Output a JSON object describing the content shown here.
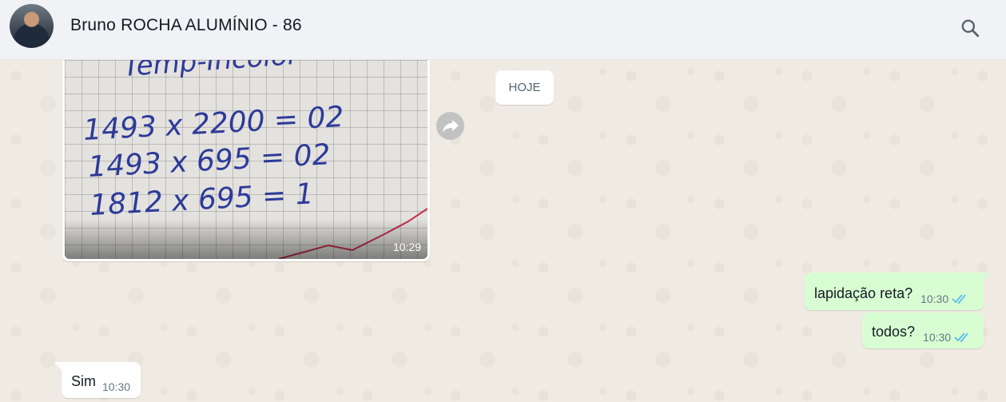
{
  "header": {
    "contact_name": "Bruno ROCHA ALUMÍNIO - 86",
    "avatar_icon": "contact-avatar",
    "search_icon": "search-icon"
  },
  "date_separator": "HOJE",
  "messages": [
    {
      "type": "image",
      "direction": "incoming",
      "time": "10:29",
      "image_text_lines": [
        "Temp-Incolor",
        "1493 x 2200 = 02",
        "1493 x 695 = 02",
        "1812 x 695 = 1"
      ]
    },
    {
      "type": "text",
      "direction": "outgoing",
      "text": "lapidação reta?",
      "time": "10:30",
      "status": "read"
    },
    {
      "type": "text",
      "direction": "outgoing",
      "text": "todos?",
      "time": "10:30",
      "status": "read"
    },
    {
      "type": "text",
      "direction": "incoming",
      "text": "Sim",
      "time": "10:30"
    }
  ],
  "colors": {
    "header_bg": "#f0f2f5",
    "chat_bg": "#efeae2",
    "outgoing_bubble": "#d9fdd3",
    "incoming_bubble": "#ffffff",
    "read_check": "#53bdeb",
    "handwriting_ink": "#2d3a9a"
  }
}
